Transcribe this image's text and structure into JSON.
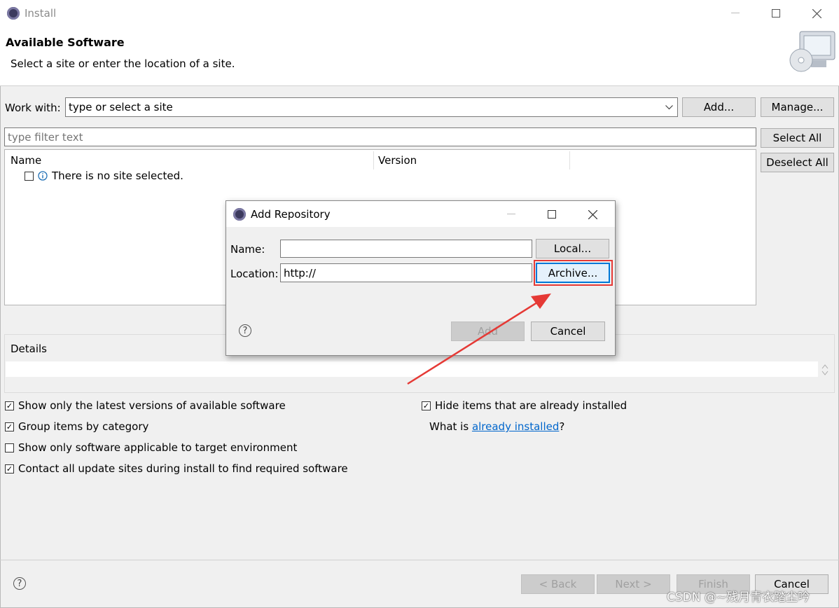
{
  "window": {
    "title": "Install"
  },
  "header": {
    "title": "Available Software",
    "subtitle": "Select a site or enter the location of a site."
  },
  "work_with": {
    "label": "Work with:",
    "value": "type or select a site",
    "add_label": "Add...",
    "manage_label": "Manage..."
  },
  "filter": {
    "placeholder": "type filter text",
    "select_all": "Select All",
    "deselect_all": "Deselect All"
  },
  "table": {
    "columns": [
      "Name",
      "Version"
    ],
    "rows": [
      {
        "name": "There is no site selected."
      }
    ]
  },
  "details": {
    "label": "Details"
  },
  "options": {
    "left": [
      {
        "label": "Show only the latest versions of available software",
        "checked": true
      },
      {
        "label": "Group items by category",
        "checked": true
      },
      {
        "label": "Show only software applicable to target environment",
        "checked": false
      },
      {
        "label": "Contact all update sites during install to find required software",
        "checked": true
      }
    ],
    "right": [
      {
        "label": "Hide items that are already installed",
        "checked": true
      }
    ],
    "what_is_prefix": "What is ",
    "what_is_link": "already installed",
    "what_is_suffix": "?"
  },
  "dialog": {
    "title": "Add Repository",
    "name_label": "Name:",
    "name_value": "",
    "location_label": "Location:",
    "location_value": "http://",
    "local_button": "Local...",
    "archive_button": "Archive...",
    "add_button": "Add",
    "cancel_button": "Cancel"
  },
  "footer": {
    "back": "< Back",
    "next": "Next >",
    "finish": "Finish",
    "cancel": "Cancel"
  },
  "watermark": "CSDN @~残月青衣踏尘吟",
  "colors": {
    "annotation_red": "#e53935",
    "link": "#0066cc",
    "archive_focus": "#0078d7"
  }
}
